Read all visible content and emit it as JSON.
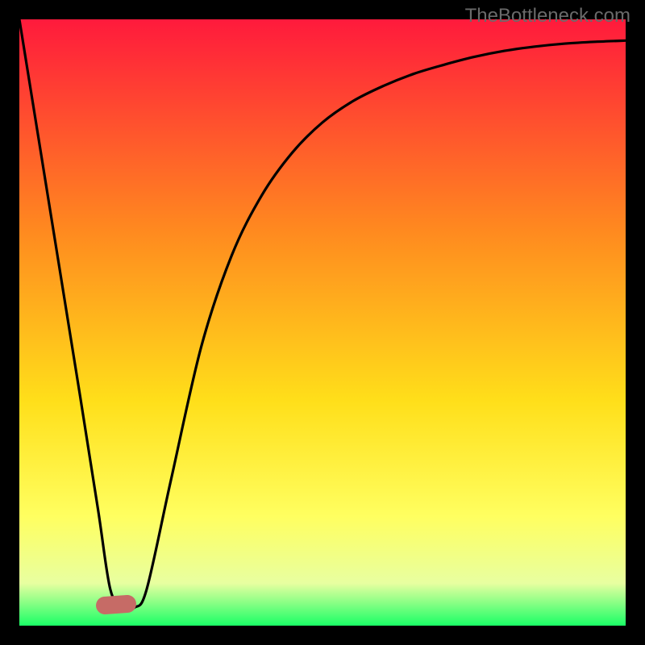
{
  "watermark": "TheBottleneck.com",
  "colors": {
    "gradient_top": "#ff1a3c",
    "gradient_upper_mid": "#ff8a1f",
    "gradient_mid": "#ffdf1a",
    "gradient_lower_mid": "#ffff60",
    "gradient_near_bottom": "#e8ffa0",
    "gradient_bottom": "#1aff66",
    "curve": "#000000",
    "marker": "#c66b66"
  },
  "chart_data": {
    "type": "line",
    "title": "",
    "xlabel": "",
    "ylabel": "",
    "xlim": [
      0,
      100
    ],
    "ylim": [
      0,
      100
    ],
    "series": [
      {
        "name": "bottleneck-curve",
        "x": [
          0,
          5,
          10,
          13,
          15,
          17,
          19,
          21,
          25,
          30,
          35,
          40,
          45,
          50,
          55,
          60,
          65,
          70,
          75,
          80,
          85,
          90,
          95,
          100
        ],
        "y": [
          100,
          69,
          38,
          19,
          6,
          3,
          3,
          6,
          24,
          46,
          61,
          71,
          78,
          83,
          86.5,
          89,
          91,
          92.5,
          93.8,
          94.8,
          95.5,
          96,
          96.3,
          96.5
        ]
      }
    ],
    "annotations": [
      {
        "name": "dip-marker",
        "x": 16,
        "y": 3
      }
    ]
  }
}
